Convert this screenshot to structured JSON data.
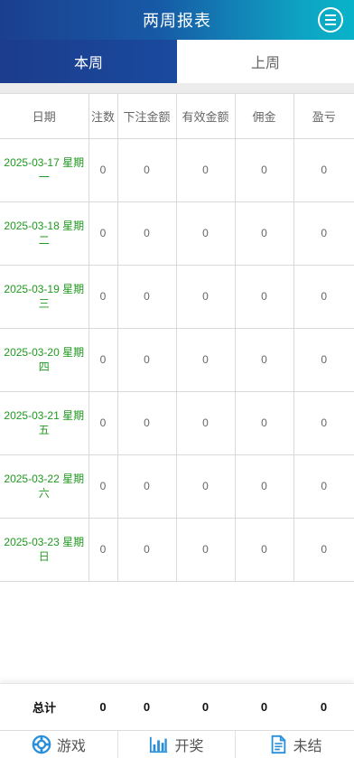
{
  "header": {
    "title": "两周报表",
    "menu_icon": "menu-icon"
  },
  "tabs": [
    {
      "label": "本周",
      "active": true
    },
    {
      "label": "上周",
      "active": false
    }
  ],
  "table": {
    "columns": [
      "日期",
      "注数",
      "下注金额",
      "有效金额",
      "佣金",
      "盈亏"
    ],
    "rows": [
      {
        "date": "2025-03-17 星期一",
        "count": "0",
        "bet": "0",
        "valid": "0",
        "commission": "0",
        "profit": "0"
      },
      {
        "date": "2025-03-18 星期二",
        "count": "0",
        "bet": "0",
        "valid": "0",
        "commission": "0",
        "profit": "0"
      },
      {
        "date": "2025-03-19 星期三",
        "count": "0",
        "bet": "0",
        "valid": "0",
        "commission": "0",
        "profit": "0"
      },
      {
        "date": "2025-03-20 星期四",
        "count": "0",
        "bet": "0",
        "valid": "0",
        "commission": "0",
        "profit": "0"
      },
      {
        "date": "2025-03-21 星期五",
        "count": "0",
        "bet": "0",
        "valid": "0",
        "commission": "0",
        "profit": "0"
      },
      {
        "date": "2025-03-22 星期六",
        "count": "0",
        "bet": "0",
        "valid": "0",
        "commission": "0",
        "profit": "0"
      },
      {
        "date": "2025-03-23 星期日",
        "count": "0",
        "bet": "0",
        "valid": "0",
        "commission": "0",
        "profit": "0"
      }
    ]
  },
  "totals": {
    "label": "总计",
    "count": "0",
    "bet": "0",
    "valid": "0",
    "commission": "0",
    "profit": "0"
  },
  "nav": [
    {
      "label": "游戏",
      "icon": "lifebuoy-icon"
    },
    {
      "label": "开奖",
      "icon": "bar-chart-icon"
    },
    {
      "label": "未结",
      "icon": "document-icon"
    }
  ],
  "colors": {
    "header_start": "#1b3f8f",
    "header_end": "#08b3c9",
    "date_text": "#1e9a1e",
    "icon_blue": "#2a8fd8"
  }
}
